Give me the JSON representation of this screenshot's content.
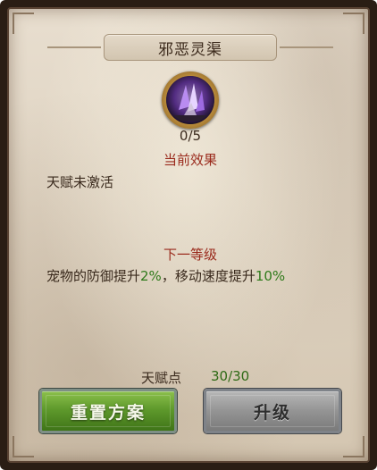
{
  "panel": {
    "title": "邪恶灵渠",
    "icon": "purple-crystal-icon",
    "progress": "0/5"
  },
  "current_effect": {
    "heading": "当前效果",
    "text": "天赋未激活"
  },
  "next_level": {
    "heading": "下一等级",
    "text_part1": "宠物的防御提升",
    "value1": "2%",
    "text_part2": "，移动速度提升",
    "value2": "10%"
  },
  "talent_points": {
    "label": "天赋点",
    "value": "30/30"
  },
  "buttons": {
    "reset_label": "重置方案",
    "upgrade_label": "升级"
  },
  "colors": {
    "heading_red": "#9a2a1c",
    "highlight_green": "#2f7a1b",
    "reset_green": "#5f9a2c",
    "upgrade_gray": "#949494"
  }
}
